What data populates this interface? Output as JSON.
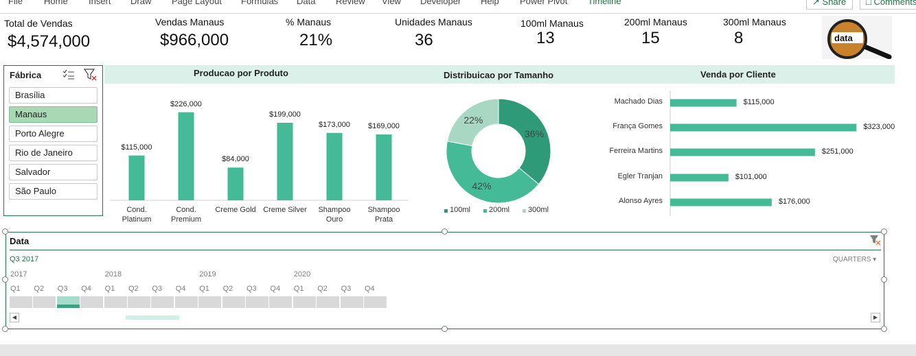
{
  "ribbon": {
    "menu": [
      "File",
      "Home",
      "Insert",
      "Draw",
      "Page Layout",
      "Formulas",
      "Data",
      "Review",
      "View",
      "Developer",
      "Help",
      "Power Pivot",
      "Timeline"
    ],
    "share_label": "Share",
    "comments_label": "Comments"
  },
  "kpis": [
    {
      "label": "Total de Vendas",
      "value": "$4,574,000"
    },
    {
      "label": "Vendas Manaus",
      "value": "$966,000"
    },
    {
      "label": "% Manaus",
      "value": "21%"
    },
    {
      "label": "Unidades Manaus",
      "value": "36"
    },
    {
      "label": "100ml Manaus",
      "value": "13"
    },
    {
      "label": "200ml Manaus",
      "value": "15"
    },
    {
      "label": "300ml Manaus",
      "value": "8"
    }
  ],
  "logo": {
    "text": "data"
  },
  "slicer": {
    "title": "Fábrica",
    "items": [
      "Brasília",
      "Manaus",
      "Porto Alegre",
      "Rio de Janeiro",
      "Salvador",
      "São Paulo"
    ],
    "selected": "Manaus"
  },
  "chart_data": [
    {
      "type": "bar",
      "title": "Producao por Produto",
      "categories": [
        [
          "Cond.",
          "Platinum"
        ],
        [
          "Cond.",
          "Premium"
        ],
        [
          "Creme Gold"
        ],
        [
          "Creme Silver"
        ],
        [
          "Shampoo",
          "Ouro"
        ],
        [
          "Shampoo",
          "Prata"
        ]
      ],
      "values": [
        115000,
        226000,
        84000,
        199000,
        173000,
        169000
      ],
      "labels": [
        "$115,000",
        "$226,000",
        "$84,000",
        "$199,000",
        "$173,000",
        "$169,000"
      ],
      "ylim": [
        0,
        250000
      ],
      "color": "#44bb96"
    },
    {
      "type": "pie",
      "title": "Distribuicao por Tamanho",
      "categories": [
        "100ml",
        "200ml",
        "300ml"
      ],
      "values": [
        36,
        42,
        22
      ],
      "labels": [
        "36%",
        "42%",
        "22%"
      ],
      "colors": [
        "#2e9a78",
        "#44bb96",
        "#a8d8c4"
      ],
      "legend": "bottom"
    },
    {
      "type": "bar",
      "orientation": "horizontal",
      "title": "Venda por Cliente",
      "categories": [
        "Machado Dias",
        "França Gomes",
        "Ferreira Martins",
        "Egler Tranjan",
        "Alonso Ayres"
      ],
      "values": [
        115000,
        323000,
        251000,
        101000,
        176000
      ],
      "labels": [
        "$115,000",
        "$323,000",
        "$251,000",
        "$101,000",
        "$176,000"
      ],
      "xlim": [
        0,
        350000
      ],
      "color": "#44bb96"
    }
  ],
  "timeline": {
    "title": "Data",
    "selection": "Q3 2017",
    "level": "QUARTERS",
    "years": [
      "2017",
      "2018",
      "2019",
      "2020"
    ],
    "quarters": [
      "Q1",
      "Q2",
      "Q3",
      "Q4",
      "Q1",
      "Q2",
      "Q3",
      "Q4",
      "Q1",
      "Q2",
      "Q3",
      "Q4",
      "Q1",
      "Q2",
      "Q3",
      "Q4"
    ],
    "selected_index": 2
  }
}
